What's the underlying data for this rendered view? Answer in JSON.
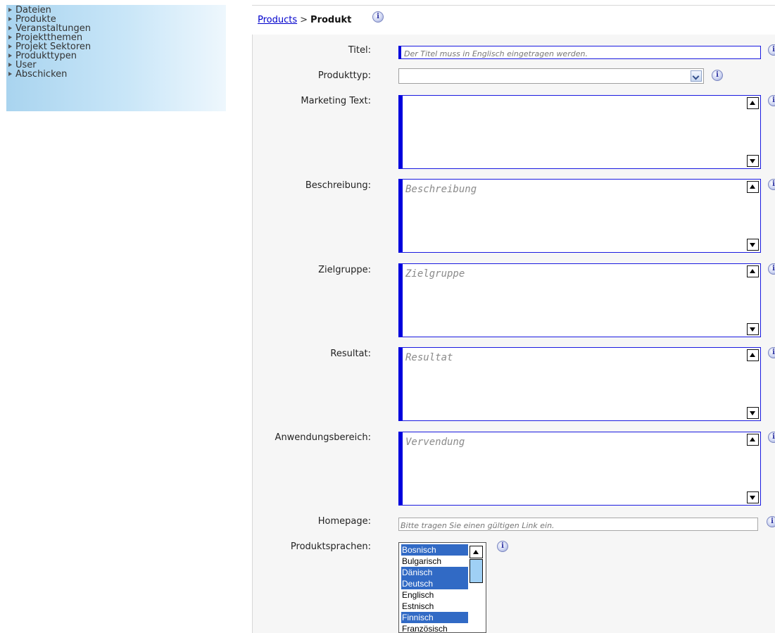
{
  "sidebar": {
    "items": [
      {
        "label": "Dateien"
      },
      {
        "label": "Produkte"
      },
      {
        "label": "Veranstaltungen"
      },
      {
        "label": "Projektthemen"
      },
      {
        "label": "Projekt Sektoren"
      },
      {
        "label": "Produkttypen"
      },
      {
        "label": "User"
      },
      {
        "label": "Abschicken"
      }
    ]
  },
  "breadcrumb": {
    "parent": "Products",
    "separator": ">",
    "current": "Produkt"
  },
  "info_icon_glyph": "i",
  "form": {
    "titel": {
      "label": "Titel:",
      "placeholder": "Der Titel muss in Englisch eingetragen werden."
    },
    "produkttyp": {
      "label": "Produkttyp:",
      "value": ""
    },
    "marketing_text": {
      "label": "Marketing Text:",
      "placeholder": ""
    },
    "beschreibung": {
      "label": "Beschreibung:",
      "placeholder": "Beschreibung"
    },
    "zielgruppe": {
      "label": "Zielgruppe:",
      "placeholder": "Zielgruppe"
    },
    "resultat": {
      "label": "Resultat:",
      "placeholder": "Resultat"
    },
    "anwendungsbereich": {
      "label": "Anwendungsbereich:",
      "placeholder": "Vervendung"
    },
    "homepage": {
      "label": "Homepage:",
      "placeholder": "Bitte tragen Sie einen gültigen Link ein."
    },
    "produktsprachen": {
      "label": "Produktsprachen:",
      "options": [
        {
          "label": "Bosnisch",
          "selected": true
        },
        {
          "label": "Bulgarisch",
          "selected": false
        },
        {
          "label": "Dänisch",
          "selected": true
        },
        {
          "label": "Deutsch",
          "selected": true
        },
        {
          "label": "Englisch",
          "selected": false
        },
        {
          "label": "Estnisch",
          "selected": false
        },
        {
          "label": "Finnisch",
          "selected": true
        },
        {
          "label": "Französisch",
          "selected": false
        }
      ]
    }
  },
  "colors": {
    "required_border": "#0000dd",
    "selected_option": "#316ac5",
    "sidebar_gradient_start": "#a9d4ef",
    "link": "#0000cc"
  },
  "icons": [
    "triangle-right-icon",
    "info-icon",
    "chevron-down-icon",
    "scroll-up-icon",
    "scroll-down-icon"
  ]
}
